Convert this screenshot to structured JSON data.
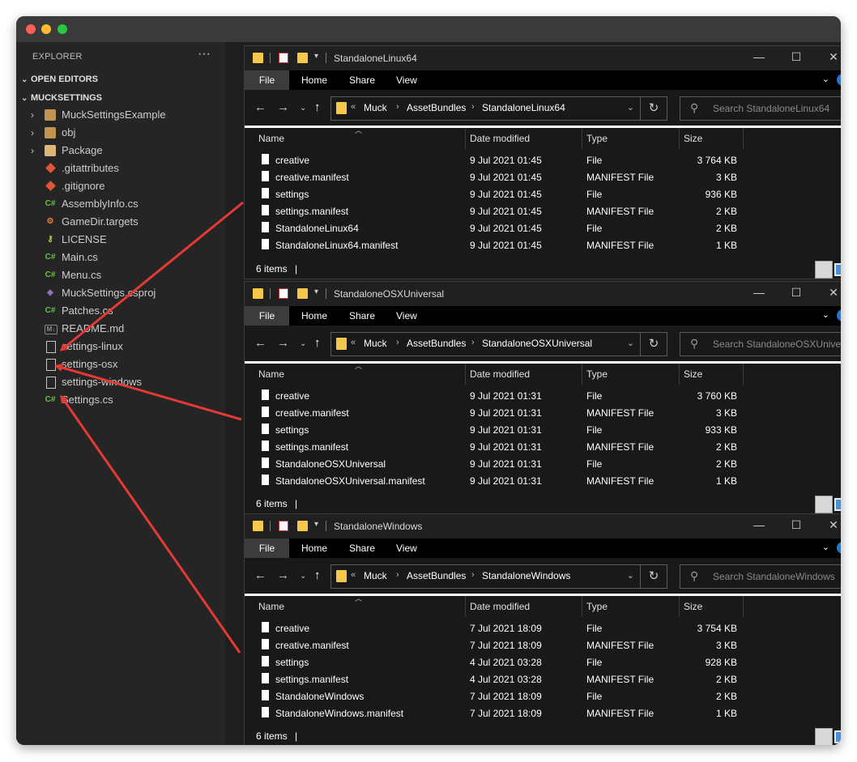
{
  "explorer": {
    "title": "EXPLORER",
    "more": "···",
    "open_editors": "OPEN EDITORS",
    "project": "MUCKSETTINGS",
    "items": [
      {
        "label": "MuckSettingsExample",
        "kind": "folder",
        "chevron": "›"
      },
      {
        "label": "obj",
        "kind": "folder",
        "chevron": "›"
      },
      {
        "label": "Package",
        "kind": "folder-open",
        "chevron": "›"
      },
      {
        "label": ".gitattributes",
        "kind": "git"
      },
      {
        "label": ".gitignore",
        "kind": "git"
      },
      {
        "label": "AssemblyInfo.cs",
        "kind": "cs",
        "icon": "C#"
      },
      {
        "label": "GameDir.targets",
        "kind": "cfg",
        "icon": "⚙"
      },
      {
        "label": "LICENSE",
        "kind": "license",
        "icon": "⚷"
      },
      {
        "label": "Main.cs",
        "kind": "cs",
        "icon": "C#"
      },
      {
        "label": "Menu.cs",
        "kind": "cs",
        "icon": "C#"
      },
      {
        "label": "MuckSettings.csproj",
        "kind": "proj",
        "icon": "◈"
      },
      {
        "label": "Patches.cs",
        "kind": "cs",
        "icon": "C#"
      },
      {
        "label": "README.md",
        "kind": "md",
        "icon": "M↓"
      },
      {
        "label": "settings-linux",
        "kind": "file"
      },
      {
        "label": "settings-osx",
        "kind": "file"
      },
      {
        "label": "settings-windows",
        "kind": "file"
      },
      {
        "label": "Settings.cs",
        "kind": "cs",
        "icon": "C#"
      }
    ]
  },
  "ribbon": {
    "file": "File",
    "home": "Home",
    "share": "Share",
    "view": "View",
    "help": "?"
  },
  "columns": {
    "name": "Name",
    "date": "Date modified",
    "type": "Type",
    "size": "Size"
  },
  "windows": [
    {
      "title": "StandaloneLinux64",
      "breadcrumb": [
        "Muck",
        "AssetBundles",
        "StandaloneLinux64"
      ],
      "search_placeholder": "Search StandaloneLinux64",
      "rows": [
        {
          "name": "creative",
          "date": "9 Jul 2021 01:45",
          "type": "File",
          "size": "3 764 KB"
        },
        {
          "name": "creative.manifest",
          "date": "9 Jul 2021 01:45",
          "type": "MANIFEST File",
          "size": "3 KB"
        },
        {
          "name": "settings",
          "date": "9 Jul 2021 01:45",
          "type": "File",
          "size": "936 KB"
        },
        {
          "name": "settings.manifest",
          "date": "9 Jul 2021 01:45",
          "type": "MANIFEST File",
          "size": "2 KB"
        },
        {
          "name": "StandaloneLinux64",
          "date": "9 Jul 2021 01:45",
          "type": "File",
          "size": "2 KB"
        },
        {
          "name": "StandaloneLinux64.manifest",
          "date": "9 Jul 2021 01:45",
          "type": "MANIFEST File",
          "size": "1 KB"
        }
      ],
      "status": "6 items"
    },
    {
      "title": "StandaloneOSXUniversal",
      "breadcrumb": [
        "Muck",
        "AssetBundles",
        "StandaloneOSXUniversal"
      ],
      "search_placeholder": "Search StandaloneOSXUnive...",
      "rows": [
        {
          "name": "creative",
          "date": "9 Jul 2021 01:31",
          "type": "File",
          "size": "3 760 KB"
        },
        {
          "name": "creative.manifest",
          "date": "9 Jul 2021 01:31",
          "type": "MANIFEST File",
          "size": "3 KB"
        },
        {
          "name": "settings",
          "date": "9 Jul 2021 01:31",
          "type": "File",
          "size": "933 KB"
        },
        {
          "name": "settings.manifest",
          "date": "9 Jul 2021 01:31",
          "type": "MANIFEST File",
          "size": "2 KB"
        },
        {
          "name": "StandaloneOSXUniversal",
          "date": "9 Jul 2021 01:31",
          "type": "File",
          "size": "2 KB"
        },
        {
          "name": "StandaloneOSXUniversal.manifest",
          "date": "9 Jul 2021 01:31",
          "type": "MANIFEST File",
          "size": "1 KB"
        }
      ],
      "status": "6 items"
    },
    {
      "title": "StandaloneWindows",
      "breadcrumb": [
        "Muck",
        "AssetBundles",
        "StandaloneWindows"
      ],
      "search_placeholder": "Search StandaloneWindows",
      "rows": [
        {
          "name": "creative",
          "date": "7 Jul 2021 18:09",
          "type": "File",
          "size": "3 754 KB"
        },
        {
          "name": "creative.manifest",
          "date": "7 Jul 2021 18:09",
          "type": "MANIFEST File",
          "size": "3 KB"
        },
        {
          "name": "settings",
          "date": "4 Jul 2021 03:28",
          "type": "File",
          "size": "928 KB"
        },
        {
          "name": "settings.manifest",
          "date": "4 Jul 2021 03:28",
          "type": "MANIFEST File",
          "size": "2 KB"
        },
        {
          "name": "StandaloneWindows",
          "date": "7 Jul 2021 18:09",
          "type": "File",
          "size": "2 KB"
        },
        {
          "name": "StandaloneWindows.manifest",
          "date": "7 Jul 2021 18:09",
          "type": "MANIFEST File",
          "size": "1 KB"
        }
      ],
      "status": "6 items"
    }
  ],
  "colors": {
    "arrow": "#e53935",
    "traffic_red": "#ff5f57",
    "traffic_yellow": "#febc2e",
    "traffic_green": "#28c840",
    "cs_green": "#6ac146"
  }
}
